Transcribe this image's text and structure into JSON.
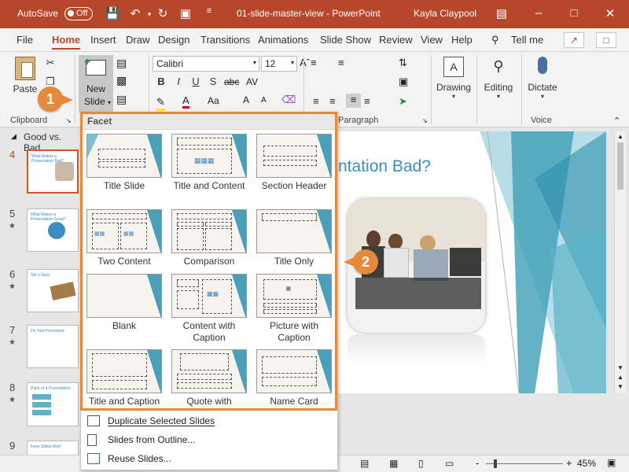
{
  "titlebar": {
    "autosave": "AutoSave",
    "autosave_state": "Off",
    "filename": "01-slide-master-view",
    "separator": "-",
    "app": "PowerPoint",
    "user": "Kayla Claypool"
  },
  "tabs": [
    "File",
    "Home",
    "Insert",
    "Draw",
    "Design",
    "Transitions",
    "Animations",
    "Slide Show",
    "Review",
    "View",
    "Help"
  ],
  "tell_me": "Tell me",
  "ribbon": {
    "paste": "Paste",
    "new": "New",
    "slide": "Slide",
    "font_name": "Calibri",
    "font_size": "12",
    "clipboard": "Clipboard",
    "paragraph": "Paragraph",
    "drawing": "Drawing",
    "editing": "Editing",
    "dictate": "Dictate",
    "voice": "Voice",
    "bold": "B",
    "italic": "I",
    "underline": "U",
    "shadow": "S",
    "strike": "abc",
    "spacing": "AV",
    "case": "Aa",
    "grow": "A",
    "shrink": "A"
  },
  "leftpane": {
    "section": "Good vs. Bad",
    "slides": [
      {
        "num": "4",
        "title": "What Makes a Presentation Bad?"
      },
      {
        "num": "5",
        "title": "What Makes a Presentation Good?"
      },
      {
        "num": "6",
        "title": "Tell a Story"
      },
      {
        "num": "7",
        "title": "Do Your Homework"
      },
      {
        "num": "8",
        "title": "Parts of a Presentation"
      },
      {
        "num": "9",
        "title": "Keep Slides Brief"
      }
    ]
  },
  "slide_title": "ntation Bad?",
  "dropdown": {
    "theme": "Facet",
    "layouts": [
      {
        "name": "Title Slide"
      },
      {
        "name": "Title and Content"
      },
      {
        "name": "Section Header"
      },
      {
        "name": "Two Content"
      },
      {
        "name": "Comparison"
      },
      {
        "name": "Title Only"
      },
      {
        "name": "Blank"
      },
      {
        "name": "Content with Caption"
      },
      {
        "name": "Picture with Caption"
      },
      {
        "name": "Title and Caption"
      },
      {
        "name": "Quote with"
      },
      {
        "name": "Name Card"
      }
    ],
    "menu": [
      {
        "label": "Duplicate Selected Slides"
      },
      {
        "label": "Slides from Outline..."
      },
      {
        "label": "Reuse Slides..."
      }
    ]
  },
  "callouts": [
    "1",
    "2"
  ],
  "status": {
    "zoom": "45%",
    "minus": "-",
    "plus": "+"
  },
  "colors": {
    "accent": "#b7472a",
    "callout": "#e58a3a",
    "slide_title": "#3a8dc0"
  }
}
